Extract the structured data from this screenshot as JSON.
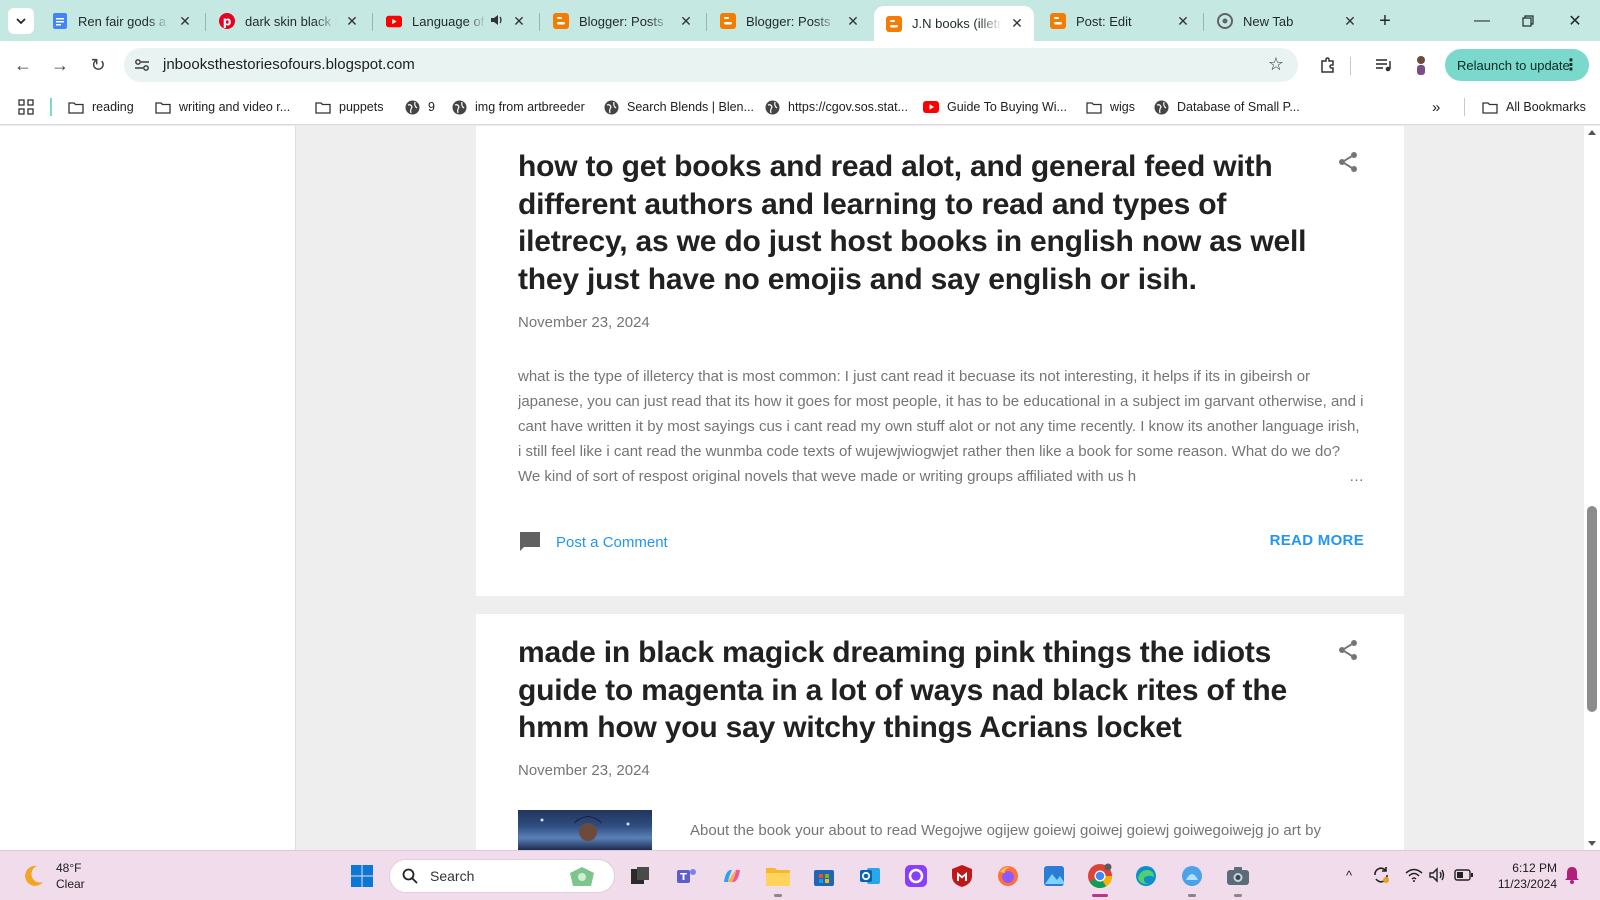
{
  "tabs": [
    {
      "title": "Ren fair gods a go",
      "favicon": "google-docs-icon",
      "color": "#4285f4"
    },
    {
      "title": "dark skin black m",
      "favicon": "pinterest-icon",
      "color": "#e60023"
    },
    {
      "title": "Language of",
      "favicon": "youtube-icon",
      "color": "#ff0000",
      "audio": true
    },
    {
      "title": "Blogger: Posts",
      "favicon": "blogger-icon",
      "color": "#f57c00"
    },
    {
      "title": "Blogger: Posts",
      "favicon": "blogger-icon",
      "color": "#f57c00"
    },
    {
      "title": "J.N books (illetra",
      "favicon": "blogger-icon",
      "color": "#f57c00",
      "active": true
    },
    {
      "title": "Post: Edit",
      "favicon": "blogger-icon",
      "color": "#f57c00"
    },
    {
      "title": "New Tab",
      "favicon": "chrome-icon",
      "color": "#5f6368"
    }
  ],
  "toolbar": {
    "url": "jnbooksthestoriesofours.blogspot.com",
    "relaunch_label": "Relaunch to update"
  },
  "bookmarks": [
    {
      "label": "reading",
      "type": "folder"
    },
    {
      "label": "writing and video r...",
      "type": "folder"
    },
    {
      "label": "puppets",
      "type": "folder"
    },
    {
      "label": "9",
      "type": "site"
    },
    {
      "label": "img from artbreeder",
      "type": "site"
    },
    {
      "label": "Search Blends | Blen...",
      "type": "site"
    },
    {
      "label": "https://cgov.sos.stat...",
      "type": "site"
    },
    {
      "label": "Guide To Buying Wi...",
      "type": "youtube"
    },
    {
      "label": "wigs",
      "type": "folder"
    },
    {
      "label": "Database of Small P...",
      "type": "site"
    }
  ],
  "bookmarks_all": "All Bookmarks",
  "posts": [
    {
      "title": "how to get books and read alot, and general feed with different authors and learning to read and types of iletrecy, as we do just host books in english now as well they just have no emojis and say english or isih.",
      "date": "November 23, 2024",
      "snippet": " what is the type of illetercy that is most common: I just cant read it becuase its not interesting, it helps if its in gibeirsh or japanese, you can just read that its how it goes for most people, it has to be educational in a subject im garvant otherwise, and i cant have written it by most sayings cus i cant read my own stuff alot or not any time recently. I know its another language irish, i still feel like i cant read the wunmba code texts of wujewjwiogwjet rather then like a book for some reason. What do we do? We kind of sort of respost original novels that weve made or writing groups affiliated with us h",
      "ellipsis": "…",
      "comment_label": "Post a Comment",
      "read_more_label": "READ MORE"
    },
    {
      "title": "made in black magick dreaming pink things the idiots guide to magenta in a lot of ways nad black rites of the hmm how you say witchy things Acrians locket",
      "date": "November 23, 2024",
      "intro": "About the book your about to read Wegojwe ogijew goiewj goiwej goiewj goiwegoiwejg jo art by"
    }
  ],
  "taskbar": {
    "temperature": "48°F",
    "condition": "Clear",
    "search_label": "Search",
    "time": "6:12 PM",
    "date": "11/23/2024"
  }
}
